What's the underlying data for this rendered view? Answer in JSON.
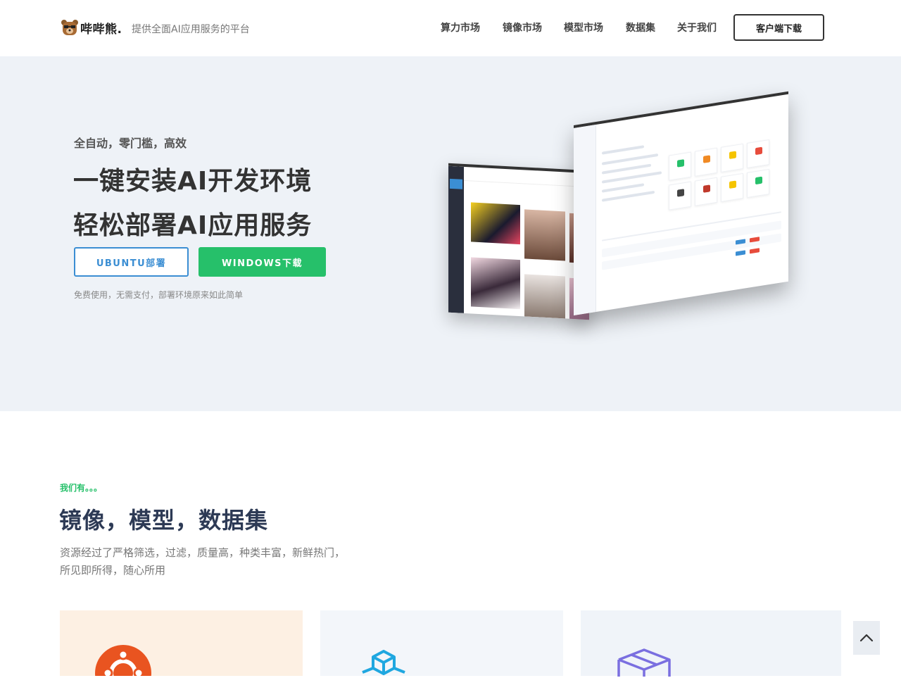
{
  "header": {
    "logo_text": "哔哔熊.",
    "slogan": "提供全面AI应用服务的平台",
    "nav": [
      "算力市场",
      "镜像市场",
      "模型市场",
      "数据集",
      "关于我们"
    ],
    "download_label": "客户端下载"
  },
  "hero": {
    "tagline": "全自动，零门槛，高效",
    "title_line1": "一键安装AI开发环境",
    "title_line2": "轻松部署AI应用服务",
    "ubuntu_button": "UBUNTU部署",
    "windows_button": "WINDOWS下载",
    "note": "免费使用，无需支付，部署环境原来如此简单"
  },
  "resources": {
    "tag": "我们有。。。",
    "title": "镜像，模型，数据集",
    "desc_line1": "资源经过了严格筛选，过滤，质量高，种类丰富，新鲜热门，",
    "desc_line2": "所见即所得，随心所用",
    "cards": [
      {
        "icon": "ubuntu-icon",
        "color": "#e95420"
      },
      {
        "icon": "cube-icon",
        "color": "#1fa7e0"
      },
      {
        "icon": "box-icon",
        "color": "#7a6fe0"
      }
    ]
  },
  "colors": {
    "accent_green": "#26c06a",
    "accent_blue": "#3b8ed3",
    "hero_bg": "#eef2f7",
    "title_dark": "#2d3a55"
  }
}
